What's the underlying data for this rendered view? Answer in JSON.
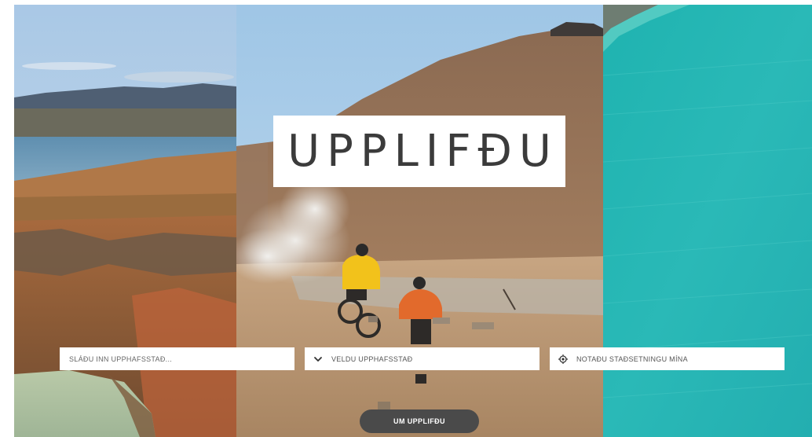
{
  "hero": {
    "title": "UPPLIFÐU"
  },
  "search": {
    "start_input_placeholder": "SLÁÐU INN UPPHAFSSTAÐ...",
    "select_label": "VELDU UPPHAFSSTAÐ",
    "select_icon": "chevron-down-icon",
    "location_label": "NOTAÐU STAÐSETNINGU MÍNA",
    "location_icon": "location-target-icon"
  },
  "about_button": {
    "label": "UM UPPLIFÐU"
  },
  "colors": {
    "title_text": "#3b3b3b",
    "button_bg": "#4a4a4a",
    "field_bg": "#ffffff"
  }
}
